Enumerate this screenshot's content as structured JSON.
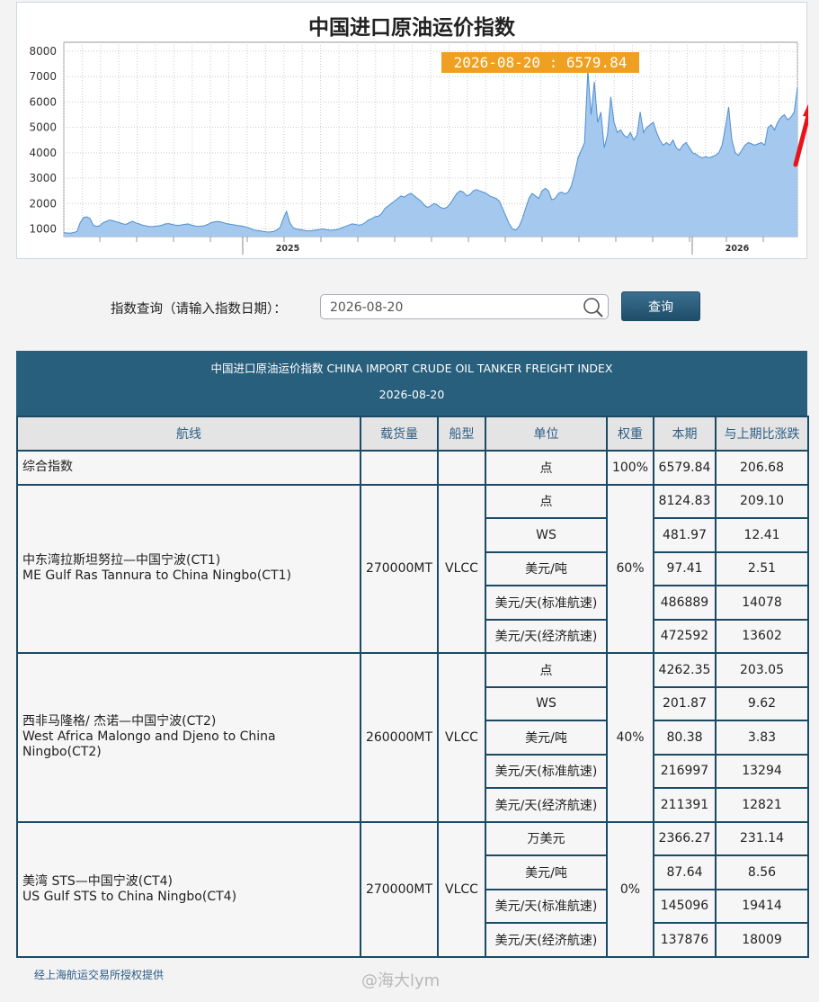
{
  "chart": {
    "title": "中国进口原油运价指数",
    "tooltip": "2026-08-20 : 6579.84",
    "accent_color": "#f0a020",
    "area_color": "#a4c8ee",
    "line_color": "#4f8fd0"
  },
  "chart_data": {
    "type": "area",
    "x_tick_labels": [
      "2025",
      "2026"
    ],
    "y_ticks": [
      1000,
      2000,
      3000,
      4000,
      5000,
      6000,
      7000,
      8000
    ],
    "ylim": [
      700,
      8350
    ],
    "grid": true,
    "values": [
      850,
      840,
      830,
      860,
      900,
      1250,
      1450,
      1480,
      1420,
      1150,
      1100,
      1130,
      1250,
      1300,
      1350,
      1330,
      1280,
      1250,
      1200,
      1180,
      1250,
      1300,
      1240,
      1200,
      1150,
      1120,
      1100,
      1090,
      1110,
      1120,
      1150,
      1200,
      1210,
      1180,
      1150,
      1140,
      1160,
      1180,
      1200,
      1150,
      1120,
      1100,
      1110,
      1130,
      1180,
      1250,
      1280,
      1300,
      1270,
      1240,
      1200,
      1180,
      1160,
      1140,
      1120,
      1100,
      1060,
      1020,
      960,
      940,
      920,
      900,
      880,
      880,
      900,
      960,
      1050,
      1400,
      1700,
      1250,
      1050,
      1000,
      980,
      950,
      930,
      920,
      940,
      960,
      980,
      1000,
      980,
      960,
      950,
      970,
      1000,
      1050,
      1100,
      1150,
      1200,
      1180,
      1150,
      1170,
      1250,
      1350,
      1400,
      1480,
      1500,
      1600,
      1800,
      1900,
      2000,
      2100,
      2200,
      2300,
      2250,
      2350,
      2400,
      2300,
      2200,
      2100,
      1950,
      1850,
      1900,
      2000,
      1950,
      1850,
      1800,
      1850,
      2000,
      2200,
      2400,
      2500,
      2450,
      2300,
      2350,
      2500,
      2550,
      2500,
      2450,
      2400,
      2300,
      2250,
      2200,
      2100,
      1800,
      1500,
      1200,
      1000,
      950,
      1100,
      1400,
      1800,
      2200,
      2400,
      2300,
      2200,
      2500,
      2600,
      2500,
      2150,
      2200,
      2400,
      2450,
      2380,
      2450,
      2700,
      3200,
      3800,
      4100,
      4400,
      7250,
      5500,
      6800,
      5200,
      5600,
      4200,
      4700,
      6200,
      5200,
      4800,
      4900,
      4700,
      4600,
      4800,
      4500,
      4700,
      5600,
      4800,
      5000,
      5100,
      5200,
      4800,
      4500,
      4300,
      4400,
      4300,
      4500,
      4200,
      4100,
      4300,
      4400,
      4200,
      4000,
      3950,
      3850,
      3800,
      3850,
      3800,
      3850,
      3900,
      4000,
      4300,
      5000,
      5800,
      4500,
      4000,
      3900,
      4100,
      4300,
      4400,
      4350,
      4300,
      4350,
      4400,
      4300,
      5000,
      5100,
      4900,
      5200,
      5400,
      5500,
      5300,
      5400,
      5600,
      6580
    ]
  },
  "query": {
    "label": "指数查询（请输入指数日期）：",
    "date_value": "2026-08-20",
    "button_label": "查询"
  },
  "table": {
    "heading": "中国进口原油运价指数 CHINA IMPORT CRUDE OIL TANKER FREIGHT INDEX",
    "date": "2026-08-20",
    "headers": [
      "航线",
      "载货量",
      "船型",
      "单位",
      "权重",
      "本期",
      "与上期比涨跌"
    ],
    "composite": {
      "name": "综合指数",
      "unit": "点",
      "weight": "100%",
      "current": "6579.84",
      "change": "206.68"
    },
    "routes": [
      {
        "name_cn": "中东湾拉斯坦努拉—中国宁波(CT1)",
        "name_en": "ME Gulf Ras Tannura to China Ningbo(CT1)",
        "cargo": "270000MT",
        "ship": "VLCC",
        "weight": "60%",
        "rows": [
          {
            "unit": "点",
            "current": "8124.83",
            "change": "209.10"
          },
          {
            "unit": "WS",
            "current": "481.97",
            "change": "12.41"
          },
          {
            "unit": "美元/吨",
            "current": "97.41",
            "change": "2.51"
          },
          {
            "unit": "美元/天(标准航速)",
            "current": "486889",
            "change": "14078"
          },
          {
            "unit": "美元/天(经济航速)",
            "current": "472592",
            "change": "13602"
          }
        ]
      },
      {
        "name_cn": "西非马隆格/ 杰诺—中国宁波(CT2)",
        "name_en": "West Africa Malongo and Djeno to China Ningbo(CT2)",
        "cargo": "260000MT",
        "ship": "VLCC",
        "weight": "40%",
        "rows": [
          {
            "unit": "点",
            "current": "4262.35",
            "change": "203.05"
          },
          {
            "unit": "WS",
            "current": "201.87",
            "change": "9.62"
          },
          {
            "unit": "美元/吨",
            "current": "80.38",
            "change": "3.83"
          },
          {
            "unit": "美元/天(标准航速)",
            "current": "216997",
            "change": "13294"
          },
          {
            "unit": "美元/天(经济航速)",
            "current": "211391",
            "change": "12821"
          }
        ]
      },
      {
        "name_cn": "美湾 STS—中国宁波(CT4)",
        "name_en": "US Gulf STS to China Ningbo(CT4)",
        "cargo": "270000MT",
        "ship": "VLCC",
        "weight": "0%",
        "rows": [
          {
            "unit": "万美元",
            "current": "2366.27",
            "change": "231.14"
          },
          {
            "unit": "美元/吨",
            "current": "87.64",
            "change": "8.56"
          },
          {
            "unit": "美元/天(标准航速)",
            "current": "145096",
            "change": "19414"
          },
          {
            "unit": "美元/天(经济航速)",
            "current": "137876",
            "change": "18009"
          }
        ]
      }
    ]
  },
  "footer": {
    "note": "经上海航运交易所授权提供",
    "watermark": "@海大lym"
  }
}
